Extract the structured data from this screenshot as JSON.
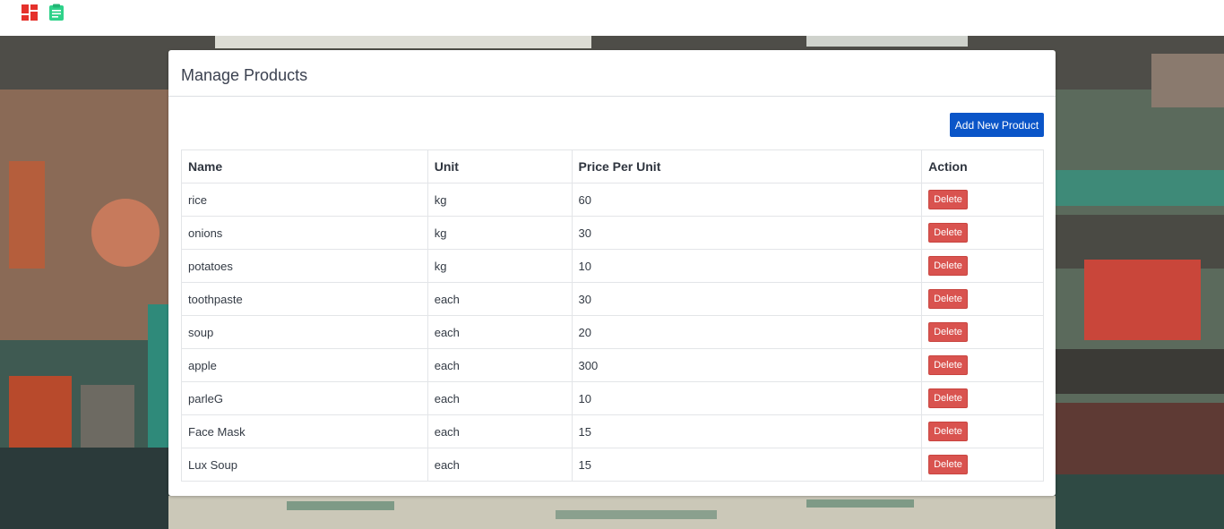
{
  "nav": {
    "icons": [
      "dashboard-icon",
      "clipboard-icon"
    ],
    "colors": {
      "dashboard": "#e5312b",
      "clipboard": "#2fd28a"
    }
  },
  "panel": {
    "title": "Manage Products",
    "add_button_label": "Add New Product"
  },
  "table": {
    "headers": [
      "Name",
      "Unit",
      "Price Per Unit",
      "Action"
    ],
    "rows": [
      {
        "name": "rice",
        "unit": "kg",
        "price": "60",
        "action": "Delete"
      },
      {
        "name": "onions",
        "unit": "kg",
        "price": "30",
        "action": "Delete"
      },
      {
        "name": "potatoes",
        "unit": "kg",
        "price": "10",
        "action": "Delete"
      },
      {
        "name": "toothpaste",
        "unit": "each",
        "price": "30",
        "action": "Delete"
      },
      {
        "name": "soup",
        "unit": "each",
        "price": "20",
        "action": "Delete"
      },
      {
        "name": "apple",
        "unit": "each",
        "price": "300",
        "action": "Delete"
      },
      {
        "name": "parleG",
        "unit": "each",
        "price": "10",
        "action": "Delete"
      },
      {
        "name": "Face Mask",
        "unit": "each",
        "price": "15",
        "action": "Delete"
      },
      {
        "name": "Lux Soup",
        "unit": "each",
        "price": "15",
        "action": "Delete"
      }
    ]
  },
  "colors": {
    "primary_button": "#0a55c8",
    "delete_button": "#d9534f"
  }
}
